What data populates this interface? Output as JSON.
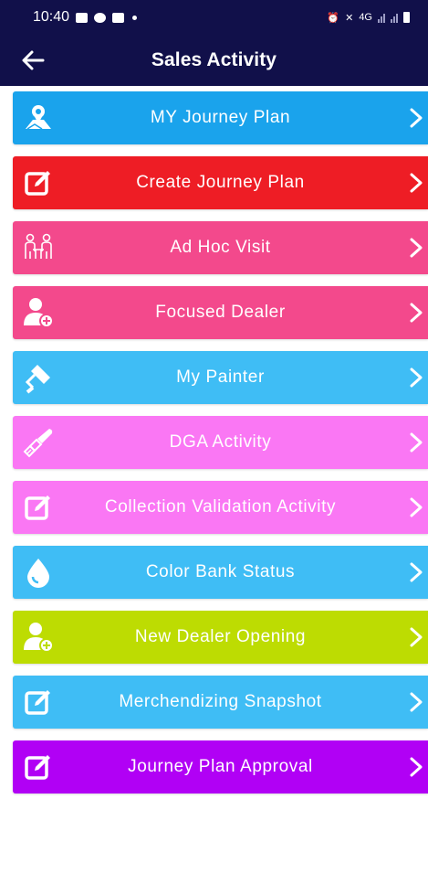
{
  "status_bar": {
    "time": "10:40",
    "network": "4G"
  },
  "header": {
    "title": "Sales Activity"
  },
  "menu_items": [
    {
      "label": "MY Journey Plan",
      "icon": "map-pin-icon",
      "color": "#1aa3ec"
    },
    {
      "label": "Create Journey Plan",
      "icon": "edit-icon",
      "color": "#ee1d25"
    },
    {
      "label": "Ad Hoc Visit",
      "icon": "meeting-icon",
      "color": "#f3498c"
    },
    {
      "label": "Focused Dealer",
      "icon": "user-add-icon",
      "color": "#f3498c"
    },
    {
      "label": "My Painter",
      "icon": "paint-roller-icon",
      "color": "#3fbdf5"
    },
    {
      "label": "DGA Activity",
      "icon": "paint-brush-icon",
      "color": "#fa77f4"
    },
    {
      "label": "Collection Validation Activity",
      "icon": "edit-icon",
      "color": "#fa77f4"
    },
    {
      "label": "Color Bank Status",
      "icon": "drop-icon",
      "color": "#3fbdf5"
    },
    {
      "label": "New Dealer Opening",
      "icon": "user-add-icon",
      "color": "#bddc02"
    },
    {
      "label": "Merchendizing Snapshot",
      "icon": "edit-icon",
      "color": "#3fbdf5"
    },
    {
      "label": "Journey Plan Approval",
      "icon": "edit-icon",
      "color": "#b100f5"
    }
  ]
}
